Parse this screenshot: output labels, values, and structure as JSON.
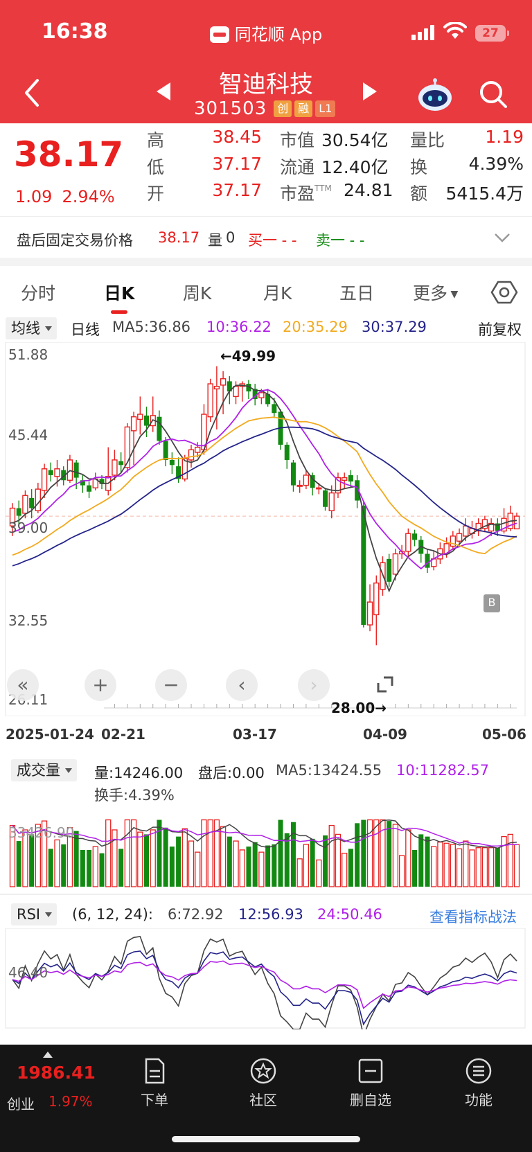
{
  "status_bar": {
    "time": "16:38",
    "app_name": "同花顺 App",
    "battery": "27"
  },
  "header": {
    "stock_name": "智迪科技",
    "stock_code": "301503",
    "tags": [
      "创",
      "融",
      "L1"
    ]
  },
  "quote": {
    "price": "38.17",
    "change": "1.09",
    "change_pct": "2.94%",
    "high_label": "高",
    "high": "38.45",
    "low_label": "低",
    "low": "37.17",
    "open_label": "开",
    "open": "37.17",
    "mktcap_label": "市值",
    "mktcap": "30.54亿",
    "float_label": "流通",
    "float": "12.40亿",
    "pe_label": "市盈",
    "pe_sup": "TTM",
    "pe": "24.81",
    "vol_ratio_label": "量比",
    "vol_ratio": "1.19",
    "turnover_label": "换",
    "turnover": "4.39%",
    "amount_label": "额",
    "amount": "5415.4万"
  },
  "after_hours": {
    "label": "盘后固定交易价格",
    "price": "38.17",
    "vol_label": "量",
    "vol": "0",
    "buy1": "买一 - -",
    "sell1": "卖一 - -"
  },
  "tabs": [
    "分时",
    "日K",
    "周K",
    "月K",
    "五日",
    "更多"
  ],
  "active_tab": "日K",
  "ma_legend": {
    "dropdown": "均线",
    "period": "日线",
    "ma5": "MA5:36.86",
    "ma10": "10:36.22",
    "ma20": "20:35.29",
    "ma30": "30:37.29",
    "adjust": "前复权"
  },
  "colors": {
    "up": "#e8201f",
    "down": "#128a12",
    "ma5": "#444444",
    "ma10": "#b020e8",
    "ma20": "#f2aa1e",
    "ma30": "#24248a",
    "header_bg": "#e93a3f"
  },
  "kline_axis": {
    "y_ticks": [
      "51.88",
      "45.44",
      "39.00",
      "32.55",
      "26.11"
    ],
    "max_label": "←49.99",
    "min_label": "28.00→",
    "x_labels": [
      "2025-01-24",
      "02-21",
      "03-17",
      "04-09",
      "05-06"
    ],
    "marker": "B"
  },
  "vol_legend": {
    "dropdown": "成交量",
    "vol": "量:14246.00",
    "after": "盘后:0.00",
    "ma5": "MA5:13424.55",
    "ma10": "10:11282.57",
    "turnover": "换手:4.39%",
    "y_tick": "33426.90"
  },
  "rsi_legend": {
    "dropdown": "RSI",
    "params": "(6, 12, 24):",
    "r6": "6:72.92",
    "r12": "12:56.93",
    "r24": "24:50.46",
    "link": "查看指标战法",
    "y_tick": "46.40"
  },
  "bottom_bar": {
    "index_value": "1986.41",
    "index_name": "创业",
    "index_pct": "1.97%",
    "nav": [
      "下单",
      "社区",
      "删自选",
      "功能"
    ]
  },
  "chart_data": [
    {
      "type": "candlestick",
      "title": "",
      "ylim": [
        26.11,
        51.88
      ],
      "y_ticks": [
        51.88,
        45.44,
        39.0,
        32.55,
        26.11
      ],
      "x_labels": [
        "2025-01-24",
        "02-21",
        "03-17",
        "04-09",
        "05-06"
      ],
      "candles": [
        [
          37.4,
          38.8,
          36.6,
          39.2
        ],
        [
          38.8,
          38.2,
          37.4,
          39.4
        ],
        [
          38.4,
          39.8,
          38.0,
          40.2
        ],
        [
          39.6,
          38.8,
          38.0,
          40.3
        ],
        [
          38.6,
          40.3,
          38.4,
          40.8
        ],
        [
          40.2,
          41.9,
          39.6,
          42.3
        ],
        [
          41.8,
          41.4,
          40.9,
          42.4
        ],
        [
          41.3,
          41.9,
          40.5,
          42.6
        ],
        [
          41.8,
          41.0,
          40.6,
          42.1
        ],
        [
          41.0,
          42.6,
          40.8,
          43.0
        ],
        [
          42.4,
          41.2,
          40.3,
          42.6
        ],
        [
          41.0,
          40.6,
          40.0,
          41.4
        ],
        [
          40.6,
          40.1,
          39.6,
          40.9
        ],
        [
          40.4,
          41.1,
          40.2,
          41.6
        ],
        [
          41.1,
          40.7,
          40.3,
          41.4
        ],
        [
          40.2,
          41.3,
          39.8,
          43.6
        ],
        [
          41.4,
          42.6,
          41.0,
          43.4
        ],
        [
          42.5,
          42.2,
          41.6,
          43.2
        ],
        [
          42.0,
          45.2,
          41.6,
          45.5
        ],
        [
          44.9,
          46.0,
          42.2,
          46.4
        ],
        [
          45.8,
          46.2,
          44.6,
          47.6
        ],
        [
          46.1,
          45.3,
          44.4,
          46.8
        ],
        [
          45.3,
          46.1,
          44.8,
          47.6
        ],
        [
          46.0,
          44.1,
          43.8,
          46.5
        ],
        [
          44.1,
          42.6,
          42.1,
          44.4
        ],
        [
          42.6,
          42.2,
          41.5,
          43.2
        ],
        [
          42.1,
          41.1,
          40.8,
          42.8
        ],
        [
          41.1,
          42.7,
          40.9,
          43.0
        ],
        [
          42.6,
          43.4,
          42.0,
          43.8
        ],
        [
          43.2,
          43.6,
          42.8,
          44.0
        ],
        [
          43.4,
          46.2,
          43.0,
          47.0
        ],
        [
          46.0,
          48.6,
          45.6,
          49.0
        ],
        [
          48.2,
          48.4,
          45.0,
          49.99
        ],
        [
          48.5,
          49.0,
          46.2,
          49.6
        ],
        [
          48.8,
          48.0,
          47.0,
          49.2
        ],
        [
          47.6,
          48.4,
          47.0,
          48.8
        ],
        [
          48.4,
          48.6,
          47.2,
          48.8
        ],
        [
          48.6,
          48.0,
          47.4,
          48.9
        ],
        [
          48.2,
          47.4,
          46.9,
          48.6
        ],
        [
          47.5,
          47.9,
          47.0,
          48.2
        ],
        [
          47.8,
          47.0,
          46.8,
          48.2
        ],
        [
          47.0,
          46.3,
          45.9,
          47.5
        ],
        [
          46.4,
          43.8,
          43.4,
          46.6
        ],
        [
          43.8,
          42.6,
          41.9,
          44.0
        ],
        [
          42.4,
          40.6,
          40.1,
          42.6
        ],
        [
          40.6,
          40.6,
          40.0,
          41.0
        ],
        [
          40.6,
          41.4,
          40.3,
          41.8
        ],
        [
          41.4,
          40.4,
          39.8,
          41.6
        ],
        [
          40.4,
          40.4,
          39.9,
          40.8
        ],
        [
          40.2,
          38.9,
          38.6,
          40.4
        ],
        [
          38.6,
          40.0,
          38.0,
          40.6
        ],
        [
          40.0,
          41.2,
          39.6,
          41.6
        ],
        [
          41.0,
          41.2,
          40.3,
          41.6
        ],
        [
          41.4,
          40.9,
          40.4,
          41.8
        ],
        [
          41.0,
          39.4,
          38.8,
          41.4
        ],
        [
          39.0,
          29.6,
          29.4,
          39.3
        ],
        [
          29.6,
          31.4,
          29.1,
          32.8
        ],
        [
          30.4,
          32.9,
          28.0,
          33.5
        ],
        [
          32.4,
          34.5,
          31.9,
          35.0
        ],
        [
          34.8,
          33.0,
          32.6,
          35.2
        ],
        [
          33.6,
          35.2,
          33.1,
          35.6
        ],
        [
          35.2,
          35.4,
          34.8,
          35.9
        ],
        [
          35.4,
          36.8,
          35.0,
          37.2
        ],
        [
          36.8,
          36.3,
          35.8,
          37.1
        ],
        [
          36.3,
          35.2,
          34.5,
          36.6
        ],
        [
          35.2,
          34.1,
          33.7,
          35.6
        ],
        [
          34.2,
          34.8,
          33.9,
          35.4
        ],
        [
          34.8,
          35.6,
          34.4,
          36.1
        ],
        [
          35.2,
          36.0,
          34.9,
          36.5
        ],
        [
          35.8,
          36.6,
          35.5,
          37.0
        ],
        [
          36.2,
          36.8,
          35.9,
          37.2
        ],
        [
          36.6,
          37.4,
          36.2,
          38.0
        ],
        [
          36.8,
          37.2,
          36.4,
          37.8
        ],
        [
          37.0,
          37.6,
          36.6,
          38.0
        ],
        [
          37.2,
          37.9,
          36.9,
          38.2
        ],
        [
          37.0,
          37.6,
          36.6,
          38.0
        ],
        [
          37.6,
          37.0,
          36.6,
          38.0
        ],
        [
          37.0,
          38.0,
          36.8,
          38.8
        ],
        [
          37.2,
          38.4,
          37.0,
          39.0
        ],
        [
          37.17,
          38.17,
          37.17,
          38.45
        ]
      ]
    },
    {
      "type": "bar",
      "title": "成交量",
      "series": [
        {
          "name": "量",
          "values": []
        }
      ],
      "ylabel": "",
      "y_tick": 33426.9
    },
    {
      "type": "line",
      "title": "RSI",
      "series": [
        {
          "name": "6"
        },
        {
          "name": "12"
        },
        {
          "name": "24"
        }
      ],
      "y_tick": 46.4
    }
  ]
}
